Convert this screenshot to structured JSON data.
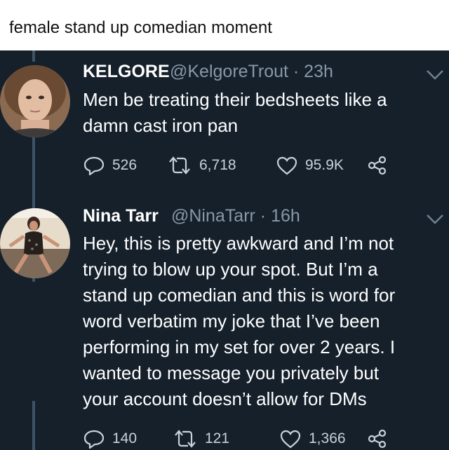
{
  "caption": "female stand up comedian moment",
  "colors": {
    "background": "#15202b",
    "text": "#ffffff",
    "secondary": "#8899a6"
  },
  "tweets": [
    {
      "name": "KELGORE",
      "handle_time": "@KelgoreTrout · 23h",
      "lines": [
        "Men be treating their bedsheets like a",
        "damn cast iron pan"
      ],
      "replies": "526",
      "retweets": "6,718",
      "likes": "95.9K"
    },
    {
      "name": "Nina Tarr",
      "handle_time": "@NinaTarr · 16h",
      "lines": [
        "Hey, this is pretty awkward and I’m not",
        "trying to blow up your spot. But I’m a",
        "stand up comedian and this is word for",
        "word verbatim my joke that I’ve been",
        "performing in my set for over 2 years. I",
        "wanted to message you privately but",
        "your account doesn’t allow for DMs"
      ],
      "replies": "140",
      "retweets": "121",
      "likes": "1,366"
    }
  ],
  "icons": [
    "reply-icon",
    "retweet-icon",
    "like-icon",
    "share-icon",
    "chevron-down-icon"
  ]
}
